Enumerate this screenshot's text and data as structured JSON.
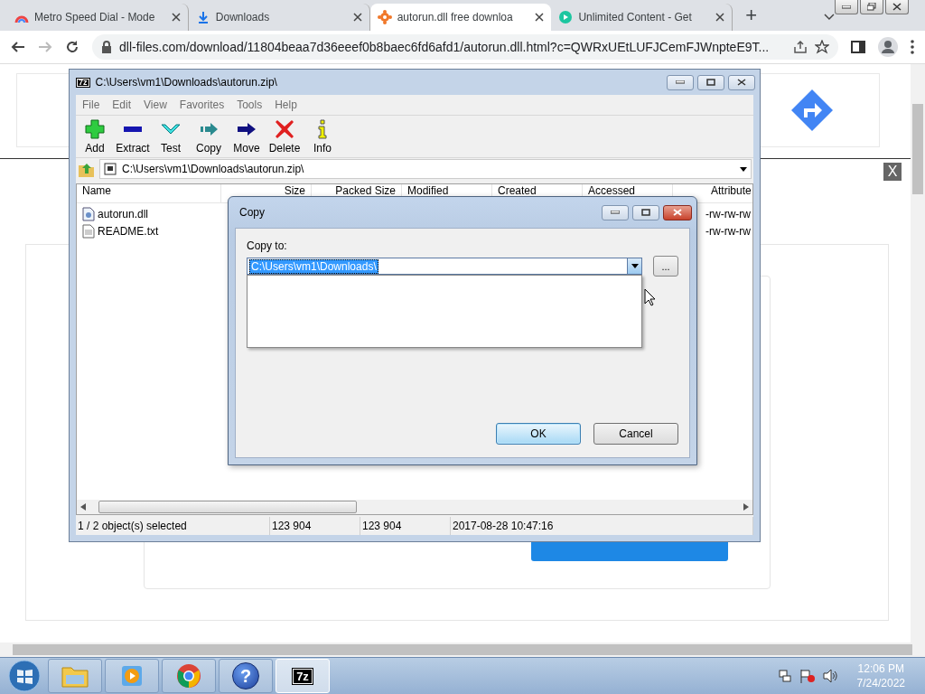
{
  "browser": {
    "tabs": [
      {
        "title": "Metro Speed Dial - Mode",
        "kind": "rainbow",
        "selected": false
      },
      {
        "title": "Downloads",
        "kind": "download",
        "selected": false
      },
      {
        "title": "autorun.dll free downloa",
        "kind": "gear",
        "selected": true
      },
      {
        "title": "Unlimited Content - Get",
        "kind": "play",
        "selected": false
      }
    ],
    "new_tab": "+",
    "address": "dll-files.com/download/11804beaa7d36eeef0b8baec6fd6afd1/autorun.dll.html?c=QWRxUEtLUFJCemFJWnpteE9T..."
  },
  "page": {
    "close_ad": "X"
  },
  "archive_window": {
    "icon_text": "7z",
    "title": "C:\\Users\\vm1\\Downloads\\autorun.zip\\",
    "menu": [
      "File",
      "Edit",
      "View",
      "Favorites",
      "Tools",
      "Help"
    ],
    "toolbar": [
      {
        "label": "Add",
        "kind": "add"
      },
      {
        "label": "Extract",
        "kind": "extract"
      },
      {
        "label": "Test",
        "kind": "test"
      },
      {
        "label": "Copy",
        "kind": "copy"
      },
      {
        "label": "Move",
        "kind": "move"
      },
      {
        "label": "Delete",
        "kind": "delete"
      },
      {
        "label": "Info",
        "kind": "info"
      }
    ],
    "path": "C:\\Users\\vm1\\Downloads\\autorun.zip\\",
    "columns": [
      "Name",
      "Size",
      "Packed Size",
      "Modified",
      "Created",
      "Accessed",
      "Attribute"
    ],
    "rows": [
      {
        "name": "autorun.dll",
        "kind": "dll",
        "attributes": "-rw-rw-rw"
      },
      {
        "name": "README.txt",
        "kind": "txt",
        "attributes": "-rw-rw-rw"
      }
    ],
    "status": [
      "1 / 2 object(s) selected",
      "123 904",
      "123 904",
      "2017-08-28 10:47:16"
    ]
  },
  "copy_dialog": {
    "title": "Copy",
    "label": "Copy to:",
    "value": "C:\\Users\\vm1\\Downloads\\",
    "browse": "...",
    "buttons": [
      {
        "label": "OK",
        "selected": true
      },
      {
        "label": "Cancel",
        "selected": false
      }
    ]
  },
  "taskbar": {
    "apps": [
      {
        "kind": "folder",
        "selected": false
      },
      {
        "kind": "media",
        "selected": false
      },
      {
        "kind": "chrome",
        "selected": false
      },
      {
        "kind": "help",
        "text": "?",
        "selected": false
      },
      {
        "kind": "sevenzip",
        "text": "7z",
        "selected": true
      }
    ],
    "time": "12:06 PM",
    "date": "7/24/2022"
  }
}
